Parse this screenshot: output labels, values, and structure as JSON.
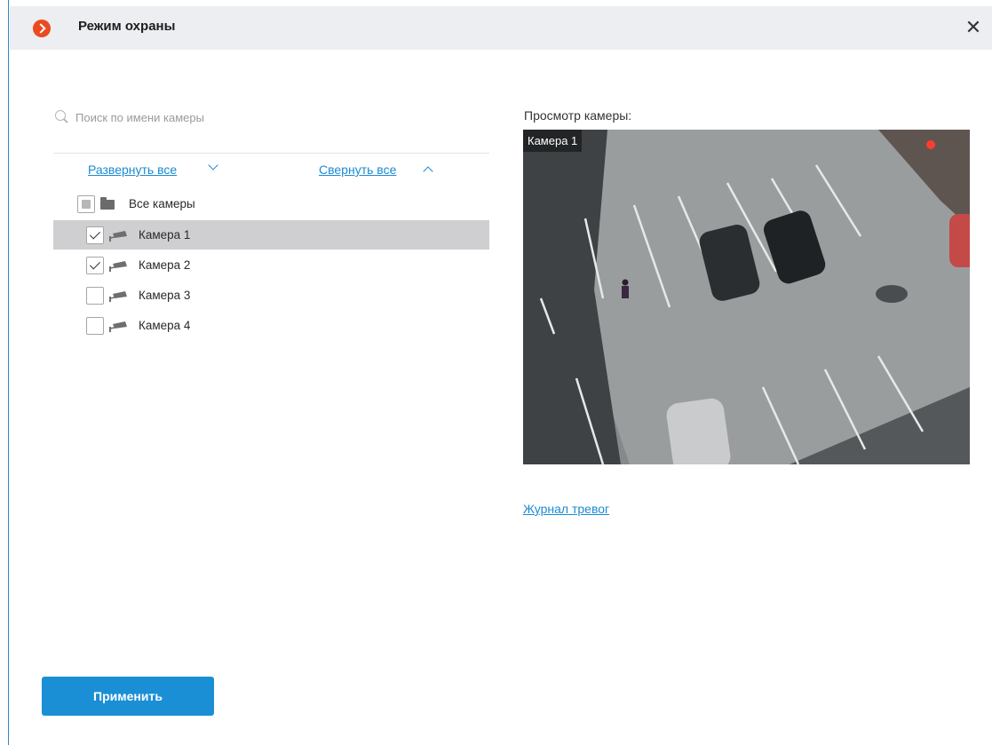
{
  "window": {
    "title": "Режим охраны",
    "close_glyph": "✕",
    "logo_icon": "chevron-right-circle-icon",
    "accent_color": "#ea4b1f"
  },
  "search": {
    "placeholder": "Поиск по имени камеры",
    "value": ""
  },
  "tree_controls": {
    "expand_all": "Развернуть все",
    "collapse_all": "Свернуть все"
  },
  "tree": {
    "root": {
      "label": "Все камеры",
      "state": "indeterminate"
    },
    "items": [
      {
        "label": "Камера 1",
        "checked": true,
        "selected": true
      },
      {
        "label": "Камера 2",
        "checked": true,
        "selected": false
      },
      {
        "label": "Камера 3",
        "checked": false,
        "selected": false
      },
      {
        "label": "Камера 4",
        "checked": false,
        "selected": false
      }
    ]
  },
  "preview": {
    "label": "Просмотр камеры:",
    "camera_name": "Камера 1",
    "recording": true
  },
  "links": {
    "alarm_journal": "Журнал тревог"
  },
  "actions": {
    "apply": "Применить",
    "apply_color": "#1a8fd6"
  },
  "colors": {
    "link": "#1b8ad3",
    "selected_row": "#cfcfd1",
    "titlebar": "#eceef1"
  }
}
